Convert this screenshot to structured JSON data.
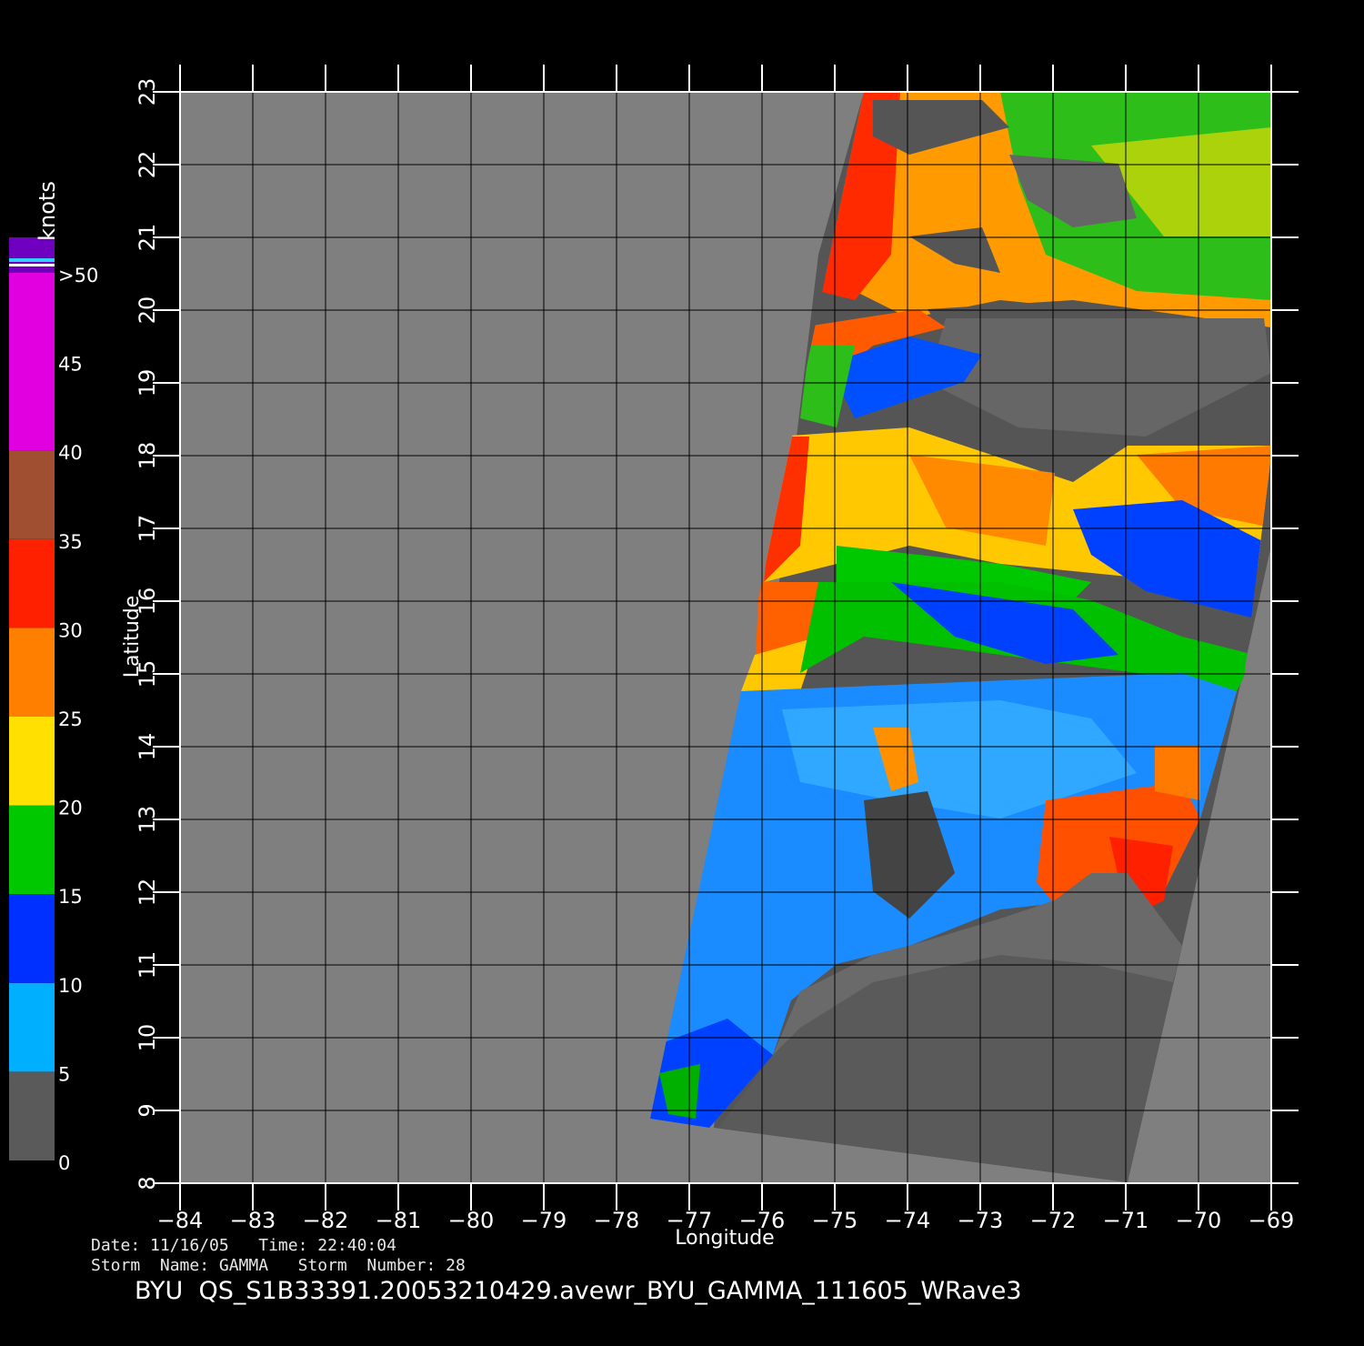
{
  "map": {
    "units_label": "knots",
    "x_axis_label": "Longitude",
    "y_axis_label": "Latitude",
    "lon_ticks": [
      "−84",
      "−83",
      "−82",
      "−81",
      "−80",
      "−79",
      "−78",
      "−77",
      "−76",
      "−75",
      "−74",
      "−73",
      "−72",
      "−71",
      "−70",
      "−69"
    ],
    "lat_ticks": [
      "8",
      "9",
      "10",
      "11",
      "12",
      "13",
      "14",
      "15",
      "16",
      "17",
      "18",
      "19",
      "20",
      "21",
      "22",
      "23"
    ],
    "lon_range": [
      -84,
      -69
    ],
    "lat_range": [
      8,
      23
    ],
    "land_color": "#4a4a4a",
    "ocean_nodata_color": "#7f7f7f"
  },
  "legend": {
    "labels": [
      ">50",
      "45",
      "40",
      "35",
      "30",
      "25",
      "20",
      "15",
      "10",
      "5",
      "0"
    ],
    "bands": [
      {
        "from": 0,
        "to": 5,
        "color": "#5a5a5a"
      },
      {
        "from": 5,
        "to": 10,
        "color": "#00b0ff"
      },
      {
        "from": 10,
        "to": 15,
        "color": "#0030ff"
      },
      {
        "from": 15,
        "to": 20,
        "color": "#00c800"
      },
      {
        "from": 20,
        "to": 25,
        "color": "#ffe000"
      },
      {
        "from": 25,
        "to": 30,
        "color": "#ff8000"
      },
      {
        "from": 30,
        "to": 35,
        "color": "#ff2000"
      },
      {
        "from": 35,
        "to": 40,
        "color": "#a05030"
      },
      {
        "from": 40,
        "to": 50,
        "color": "#e000e0"
      },
      {
        "from": 50,
        "to": 55,
        "color": "#7000c0"
      }
    ]
  },
  "meta": {
    "date_line": "Date: 11/16/05   Time: 22:40:04",
    "storm_line": "Storm  Name: GAMMA   Storm  Number: 28",
    "filename": "BYU  QS_S1B33391.20053210429.avewr_BYU_GAMMA_111605_WRave3"
  }
}
